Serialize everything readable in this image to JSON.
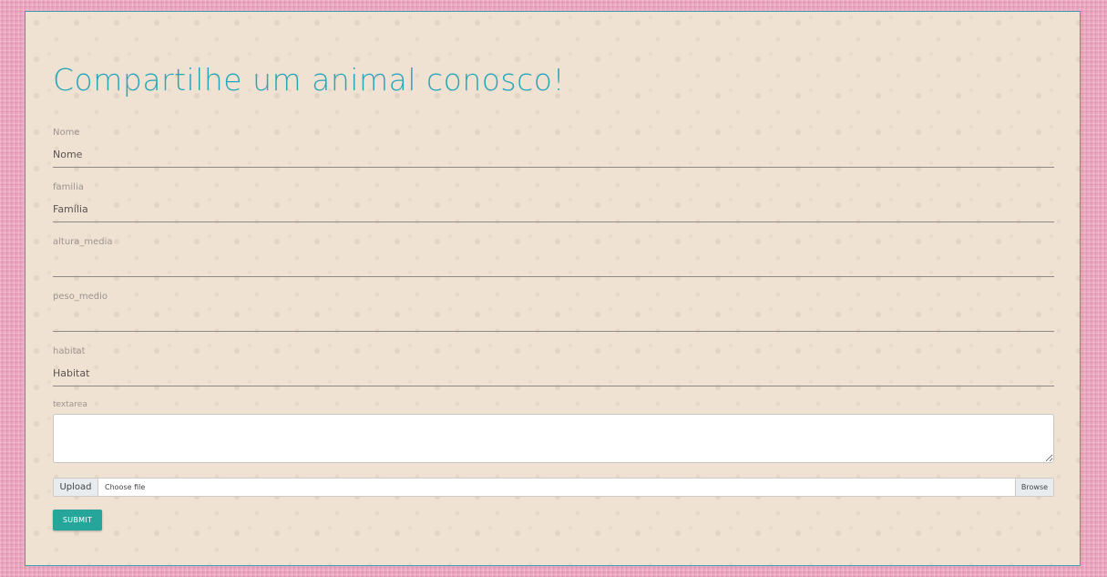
{
  "form": {
    "title": "Compartilhe um animal conosco!",
    "fields": [
      {
        "label": "Nome",
        "placeholder": "Nome",
        "value": ""
      },
      {
        "label": "familia",
        "placeholder": "Família",
        "value": ""
      },
      {
        "label": "altura_media",
        "placeholder": "",
        "value": ""
      },
      {
        "label": "peso_medio",
        "placeholder": "",
        "value": ""
      },
      {
        "label": "habitat",
        "placeholder": "Habitat",
        "value": ""
      }
    ],
    "textarea": {
      "label": "textarea",
      "value": ""
    },
    "upload": {
      "addon_label": "Upload",
      "file_text": "Choose file",
      "browse_label": "Browse"
    },
    "submit_label": "SUBMIT"
  },
  "colors": {
    "page_background": "#eba5bf",
    "card_background": "#f0e2d3",
    "title": "#27a5b8",
    "submit_button": "#26a69a"
  }
}
